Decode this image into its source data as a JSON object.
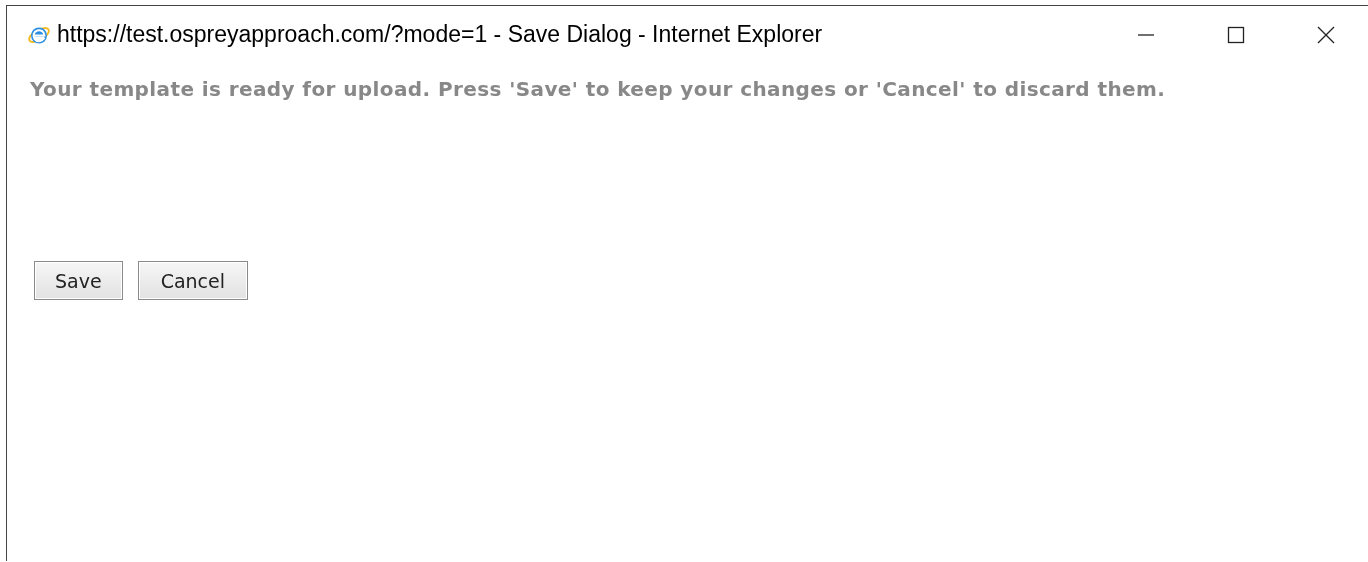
{
  "window": {
    "title": "https://test.ospreyapproach.com/?mode=1 - Save Dialog - Internet Explorer"
  },
  "message": "Your template is ready for upload. Press 'Save' to keep your changes or 'Cancel' to discard them.",
  "buttons": [
    {
      "label": "Save"
    },
    {
      "label": "Cancel"
    }
  ]
}
